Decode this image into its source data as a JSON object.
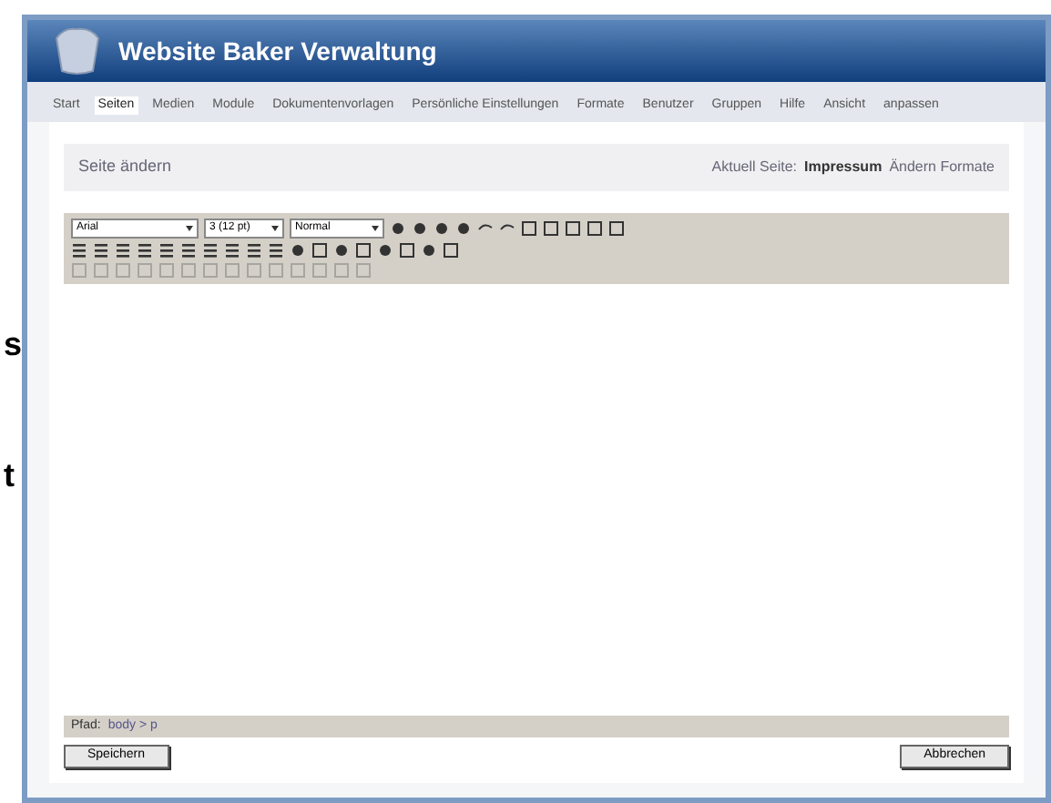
{
  "margin_letters": [
    "s",
    "t"
  ],
  "header": {
    "title": "Website Baker Verwaltung"
  },
  "menu": [
    {
      "label": "Start",
      "selected": false
    },
    {
      "label": "Seiten",
      "selected": true
    },
    {
      "label": "Medien",
      "selected": false
    },
    {
      "label": "Module",
      "selected": false
    },
    {
      "label": "Dokumentenvorlagen",
      "selected": false
    },
    {
      "label": "Persönliche Einstellungen",
      "selected": false
    },
    {
      "label": "Formate",
      "selected": false
    },
    {
      "label": "Benutzer",
      "selected": false
    },
    {
      "label": "Gruppen",
      "selected": false
    },
    {
      "label": "Hilfe",
      "selected": false
    },
    {
      "label": "Ansicht",
      "selected": false
    },
    {
      "label": "anpassen",
      "selected": false
    }
  ],
  "page_header": {
    "title": "Seite ändern",
    "current_label": "Aktuell Seite:",
    "current_page": "Impressum",
    "link": "Ändern Formate"
  },
  "toolbar": {
    "font": "Arial",
    "size": "3 (12 pt)",
    "format": "Normal"
  },
  "path_bar": {
    "label": "Pfad:",
    "value": "body > p"
  },
  "buttons": [
    {
      "label": "Speichern"
    },
    {
      "label": "Abbrechen"
    }
  ]
}
